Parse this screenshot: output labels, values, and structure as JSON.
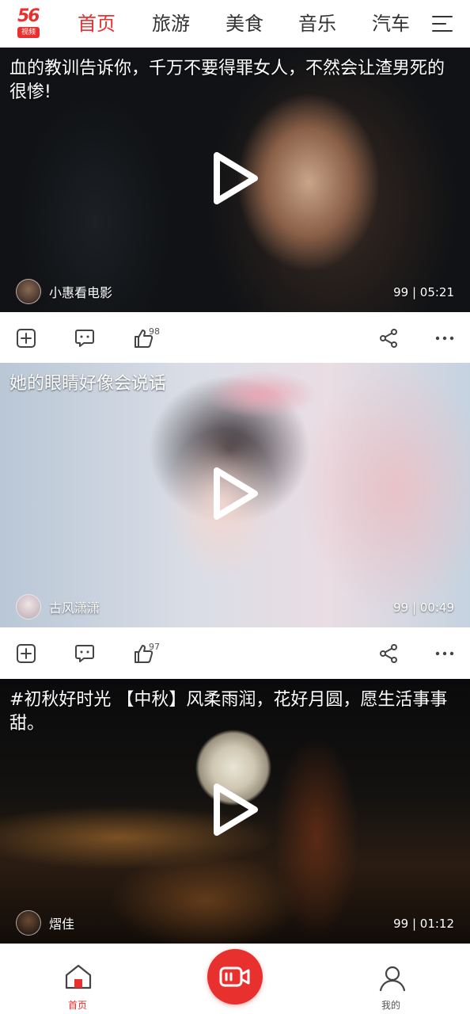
{
  "app": {
    "logo_number": "56",
    "logo_sub": "视频"
  },
  "nav": {
    "tabs": [
      {
        "label": "首页",
        "active": true
      },
      {
        "label": "旅游",
        "active": false
      },
      {
        "label": "美食",
        "active": false
      },
      {
        "label": "音乐",
        "active": false
      },
      {
        "label": "汽车",
        "active": false
      }
    ],
    "menu_icon": "hamburger-menu-icon"
  },
  "feed": [
    {
      "title": "血的教训告诉你，千万不要得罪女人，不然会让渣男死的很惨!",
      "author": "小惠看电影",
      "stats": "99 | 05:21",
      "likes": "98"
    },
    {
      "title": "她的眼睛好像会说话",
      "author": "古风潇潇",
      "stats": "99 | 00:49",
      "likes": "97"
    },
    {
      "title": "#初秋好时光 【中秋】风柔雨润，花好月圆，愿生活事事甜。",
      "author": "熠佳",
      "stats": "99 | 01:12",
      "likes": ""
    }
  ],
  "bottom_bar": {
    "home_label": "首页",
    "me_label": "我的",
    "record_icon": "video-camera-icon"
  },
  "colors": {
    "brand_red": "#e8312f",
    "text_dark": "#333333"
  }
}
